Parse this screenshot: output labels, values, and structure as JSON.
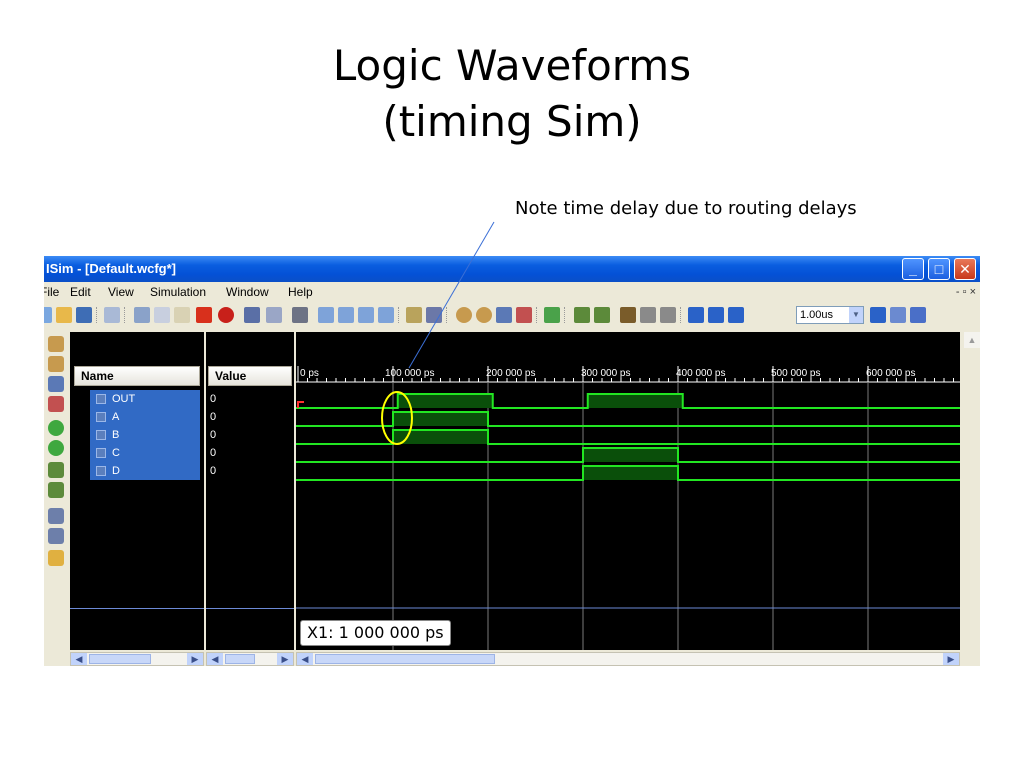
{
  "slide": {
    "title_line1": "Logic Waveforms",
    "title_line2": "(timing Sim)",
    "annotation": "Note time delay due to routing delays"
  },
  "window": {
    "title": "ISim - [Default.wcfg*]",
    "minimize": "_",
    "maximize": "□",
    "close": "✕"
  },
  "menu": {
    "items": [
      "File",
      "Edit",
      "View",
      "Simulation",
      "Window",
      "Help"
    ],
    "mdi_controls": "- ▫ ×"
  },
  "toolbar": {
    "time_value": "1.00us"
  },
  "columns": {
    "name": "Name",
    "value": "Value"
  },
  "signals": [
    {
      "name": "OUT",
      "value": "0"
    },
    {
      "name": "A",
      "value": "0"
    },
    {
      "name": "B",
      "value": "0"
    },
    {
      "name": "C",
      "value": "0"
    },
    {
      "name": "D",
      "value": "0"
    }
  ],
  "timeline": {
    "ticks": [
      "0 ps",
      "100 000 ps",
      "200 000 ps",
      "300 000 ps",
      "400 000 ps",
      "500 000 ps",
      "600 000 ps"
    ]
  },
  "cursor": {
    "label": "X1: 1 000 000 ps"
  },
  "waveforms": [
    {
      "signal": "OUT",
      "high": [
        [
          105000,
          205000
        ],
        [
          305000,
          405000
        ]
      ]
    },
    {
      "signal": "A",
      "high": [
        [
          100000,
          200000
        ]
      ]
    },
    {
      "signal": "B",
      "high": [
        [
          100000,
          200000
        ]
      ]
    },
    {
      "signal": "C",
      "high": [
        [
          300000,
          400000
        ]
      ]
    },
    {
      "signal": "D",
      "high": [
        [
          300000,
          400000
        ]
      ]
    }
  ],
  "colors": {
    "wave": "#22e622",
    "wave_fill": "#0a4f0a",
    "highlight_circle": "#ffff00",
    "selection": "#316ac5",
    "titlebar": "#0a5ee0"
  }
}
